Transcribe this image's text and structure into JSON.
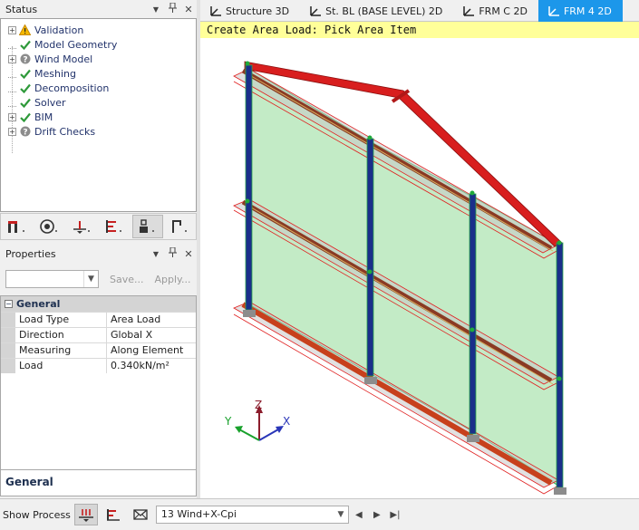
{
  "status_panel": {
    "title": "Status",
    "items": [
      {
        "label": "Validation",
        "icon": "warning-icon",
        "expandable": true
      },
      {
        "label": "Model Geometry",
        "icon": "check-icon",
        "expandable": false
      },
      {
        "label": "Wind Model",
        "icon": "question-icon",
        "expandable": true
      },
      {
        "label": "Meshing",
        "icon": "check-icon",
        "expandable": false
      },
      {
        "label": "Decomposition",
        "icon": "check-icon",
        "expandable": false
      },
      {
        "label": "Solver",
        "icon": "check-icon",
        "expandable": false
      },
      {
        "label": "BIM",
        "icon": "check-icon",
        "expandable": true
      },
      {
        "label": "Drift Checks",
        "icon": "question-icon",
        "expandable": true
      }
    ]
  },
  "panel_buttons": {
    "dropdown": "▼",
    "pin": "📌",
    "close": "✕"
  },
  "properties_panel": {
    "title": "Properties",
    "save_label": "Save...",
    "apply_label": "Apply...",
    "category": "General",
    "rows": [
      {
        "key": "Load Type",
        "value": "Area Load"
      },
      {
        "key": "Direction",
        "value": "Global X"
      },
      {
        "key": "Measuring",
        "value": "Along Element"
      },
      {
        "key": "Load",
        "value": "0.340kN/m²"
      }
    ],
    "description_title": "General"
  },
  "tabs": [
    {
      "label": "Structure 3D",
      "active": false
    },
    {
      "label": "St. BL (BASE LEVEL) 2D",
      "active": false
    },
    {
      "label": "FRM C 2D",
      "active": false
    },
    {
      "label": "FRM 4 2D",
      "active": true
    }
  ],
  "viewport": {
    "hint": "Create Area Load: Pick Area Item",
    "axis_x": "X",
    "axis_y": "Y",
    "axis_z": "Z"
  },
  "bottom_bar": {
    "show_process_label": "Show Process",
    "load_case": "13 Wind+X-Cpi"
  },
  "colors": {
    "accent": "#1c97ea",
    "hint_bg": "#ffff99",
    "beam_red": "#d81e1e",
    "column_blue": "#1a2f8a",
    "panel_green": "#b8e8bc"
  }
}
